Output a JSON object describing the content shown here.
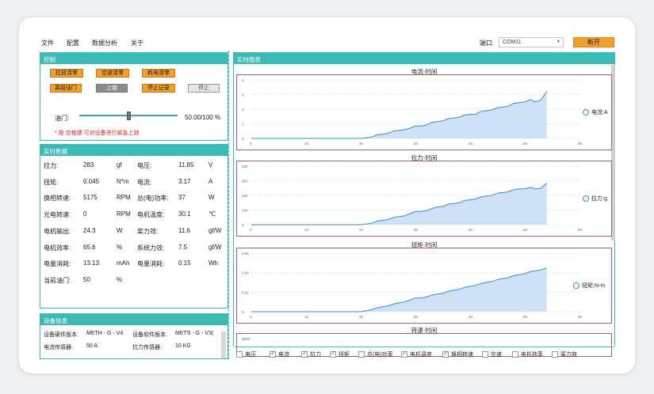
{
  "menu": [
    "文件",
    "配置",
    "数据分析",
    "关于"
  ],
  "port": {
    "label": "端口:",
    "value": "COM11"
  },
  "open_button": "断开",
  "control": {
    "title": "控制",
    "buttons_row1": [
      "拉扭清零",
      "空速清零",
      "耗电清零"
    ],
    "buttons_row2": [
      "离级油门",
      "上锁",
      "停止记录",
      "停止"
    ],
    "throttle_label": "油门:",
    "throttle_value": "50.00/100 %",
    "throttle_level": 0.5,
    "hint": "* 按 空格键 可对设备进行紧急上锁"
  },
  "realtime": {
    "title": "实时数据",
    "rows": [
      [
        "拉力:",
        "283",
        "gf",
        "电压:",
        "11.85",
        "V"
      ],
      [
        "扭矩:",
        "0.045",
        "N*m",
        "电流:",
        "3.17",
        "A"
      ],
      [
        "换相转速:",
        "5175",
        "RPM",
        "总(电)功率:",
        "37",
        "W"
      ],
      [
        "光电转速:",
        "0",
        "RPM",
        "电机温度:",
        "30.1",
        "℃"
      ],
      [
        "电机输出:",
        "24.3",
        "W",
        "桨力效:",
        "11.6",
        "gf/W"
      ],
      [
        "电机效率:",
        "65.6",
        "%",
        "系统力效:",
        "7.5",
        "gf/W"
      ],
      [
        "电量消耗:",
        "13.13",
        "mAh",
        "电量消耗:",
        "0.15",
        "Wh"
      ],
      [
        "当前油门:",
        "50",
        "%",
        "",
        "",
        ""
      ]
    ]
  },
  "device": {
    "title": "设备信息",
    "rows": [
      [
        "设备硬件版本:",
        "METH - G - V4",
        "设备软件版本:",
        "METS - G - V3("
      ],
      [
        "电流传感器:",
        "50  A",
        "拉力传感器:",
        "10  KG"
      ]
    ]
  },
  "charts_title": "实时图表",
  "charts": [
    {
      "title": "电流-时间",
      "legend": "电流:A",
      "yticks": [
        "4",
        "3",
        "2",
        "1",
        "0"
      ],
      "xticks": [
        "0",
        "10",
        "20",
        "30",
        "40",
        "50",
        "60"
      ],
      "ymax": 4,
      "values": [
        0,
        0,
        0,
        0,
        0,
        0,
        0,
        0,
        0,
        0,
        0,
        0,
        0,
        0,
        0,
        0,
        0,
        0,
        0,
        0,
        0,
        0.05,
        0.1,
        0.25,
        0.3,
        0.35,
        0.5,
        0.55,
        0.6,
        0.7,
        0.85,
        0.85,
        0.9,
        1.1,
        1.15,
        1.2,
        1.35,
        1.4,
        1.45,
        1.6,
        1.65,
        1.65,
        1.85,
        1.9,
        1.95,
        2.1,
        2.15,
        2.2,
        2.4,
        2.45,
        2.5,
        2.65,
        2.5,
        2.65,
        3.2
      ]
    },
    {
      "title": "拉力-时间",
      "legend": "拉力:g",
      "yticks": [
        "400",
        "300",
        "200",
        "100",
        "0"
      ],
      "xticks": [
        "0",
        "10",
        "20",
        "30",
        "40",
        "50",
        "60"
      ],
      "ymax": 400,
      "values": [
        0,
        0,
        0,
        0,
        0,
        0,
        0,
        0,
        0,
        0,
        0,
        0,
        0,
        0,
        0,
        0,
        0,
        0,
        0,
        0,
        0,
        5,
        10,
        25,
        30,
        35,
        50,
        55,
        60,
        75,
        90,
        90,
        95,
        110,
        120,
        125,
        140,
        145,
        150,
        165,
        170,
        175,
        190,
        195,
        200,
        215,
        220,
        225,
        240,
        245,
        245,
        255,
        245,
        250,
        285
      ]
    },
    {
      "title": "扭矩-时间",
      "legend": "扭矩:N-m",
      "yticks": [
        "0.06",
        "0.04",
        "0.02",
        "0"
      ],
      "xticks": [
        "0",
        "10",
        "20",
        "30",
        "40",
        "50",
        "60"
      ],
      "ymax": 0.06,
      "values": [
        0,
        0,
        0,
        0,
        0,
        0,
        0,
        0,
        0,
        0,
        0,
        0,
        0,
        0,
        0,
        0,
        0,
        0,
        0,
        0,
        0,
        0.001,
        0.002,
        0.004,
        0.005,
        0.006,
        0.008,
        0.009,
        0.01,
        0.012,
        0.014,
        0.014,
        0.015,
        0.017,
        0.018,
        0.019,
        0.021,
        0.022,
        0.023,
        0.025,
        0.026,
        0.027,
        0.029,
        0.03,
        0.031,
        0.033,
        0.034,
        0.035,
        0.037,
        0.038,
        0.039,
        0.041,
        0.042,
        0.043,
        0.045
      ]
    },
    {
      "title": "转速-时间",
      "yticks": [
        "8000"
      ]
    }
  ],
  "checkboxes": [
    {
      "label": "电压",
      "checked": false
    },
    {
      "label": "电流",
      "checked": true
    },
    {
      "label": "拉力",
      "checked": true
    },
    {
      "label": "扭矩",
      "checked": true
    },
    {
      "label": "总(电)功率",
      "checked": false
    },
    {
      "label": "电机温度",
      "checked": true
    },
    {
      "label": "换相转速",
      "checked": true
    },
    {
      "label": "空速",
      "checked": false
    },
    {
      "label": "电机效率",
      "checked": false
    },
    {
      "label": "桨力效",
      "checked": false
    }
  ],
  "colors": {
    "accent": "#3cbab5",
    "button": "#f0a02c",
    "series": "#3a8bd6",
    "fill": "#cfe1f6"
  }
}
